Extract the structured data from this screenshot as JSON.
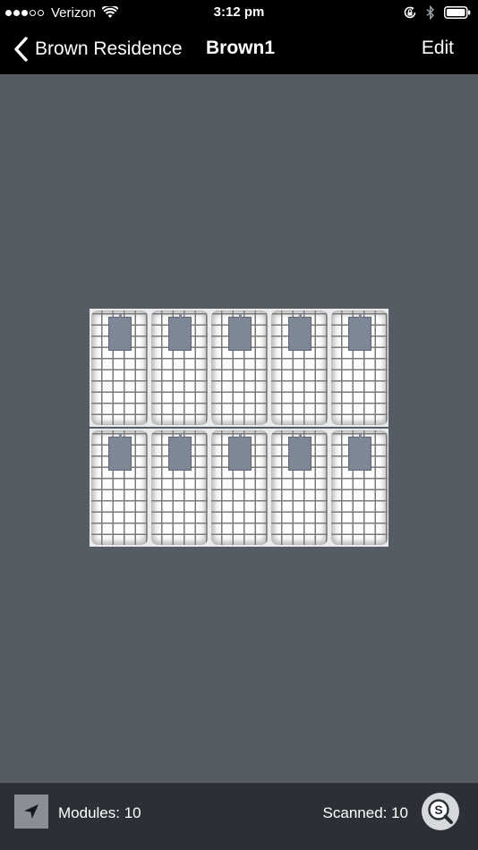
{
  "status_bar": {
    "carrier": "Verizon",
    "time": "3:12 pm",
    "signal_bars_filled": 3,
    "signal_bars_total": 5
  },
  "nav": {
    "back_label": "Brown Residence",
    "title": "Brown1",
    "edit_label": "Edit"
  },
  "array": {
    "rows": 2,
    "columns": 5,
    "module_color": "#fdfdfd",
    "inverter_color": "#7d8796"
  },
  "toolbar": {
    "modules_text": "Modules: 10",
    "scanned_text": "Scanned: 10",
    "scan_button_letter": "S"
  },
  "icons": {
    "back": "chevron-left-icon",
    "locate": "location-arrow-icon",
    "scan": "search-icon",
    "wifi": "wifi-icon",
    "rotation_lock": "rotation-lock-icon",
    "bluetooth": "bluetooth-icon",
    "battery": "battery-icon"
  },
  "colors": {
    "bar_background": "#000000",
    "canvas_background": "#565c64",
    "toolbar_background": "#2c3036"
  }
}
